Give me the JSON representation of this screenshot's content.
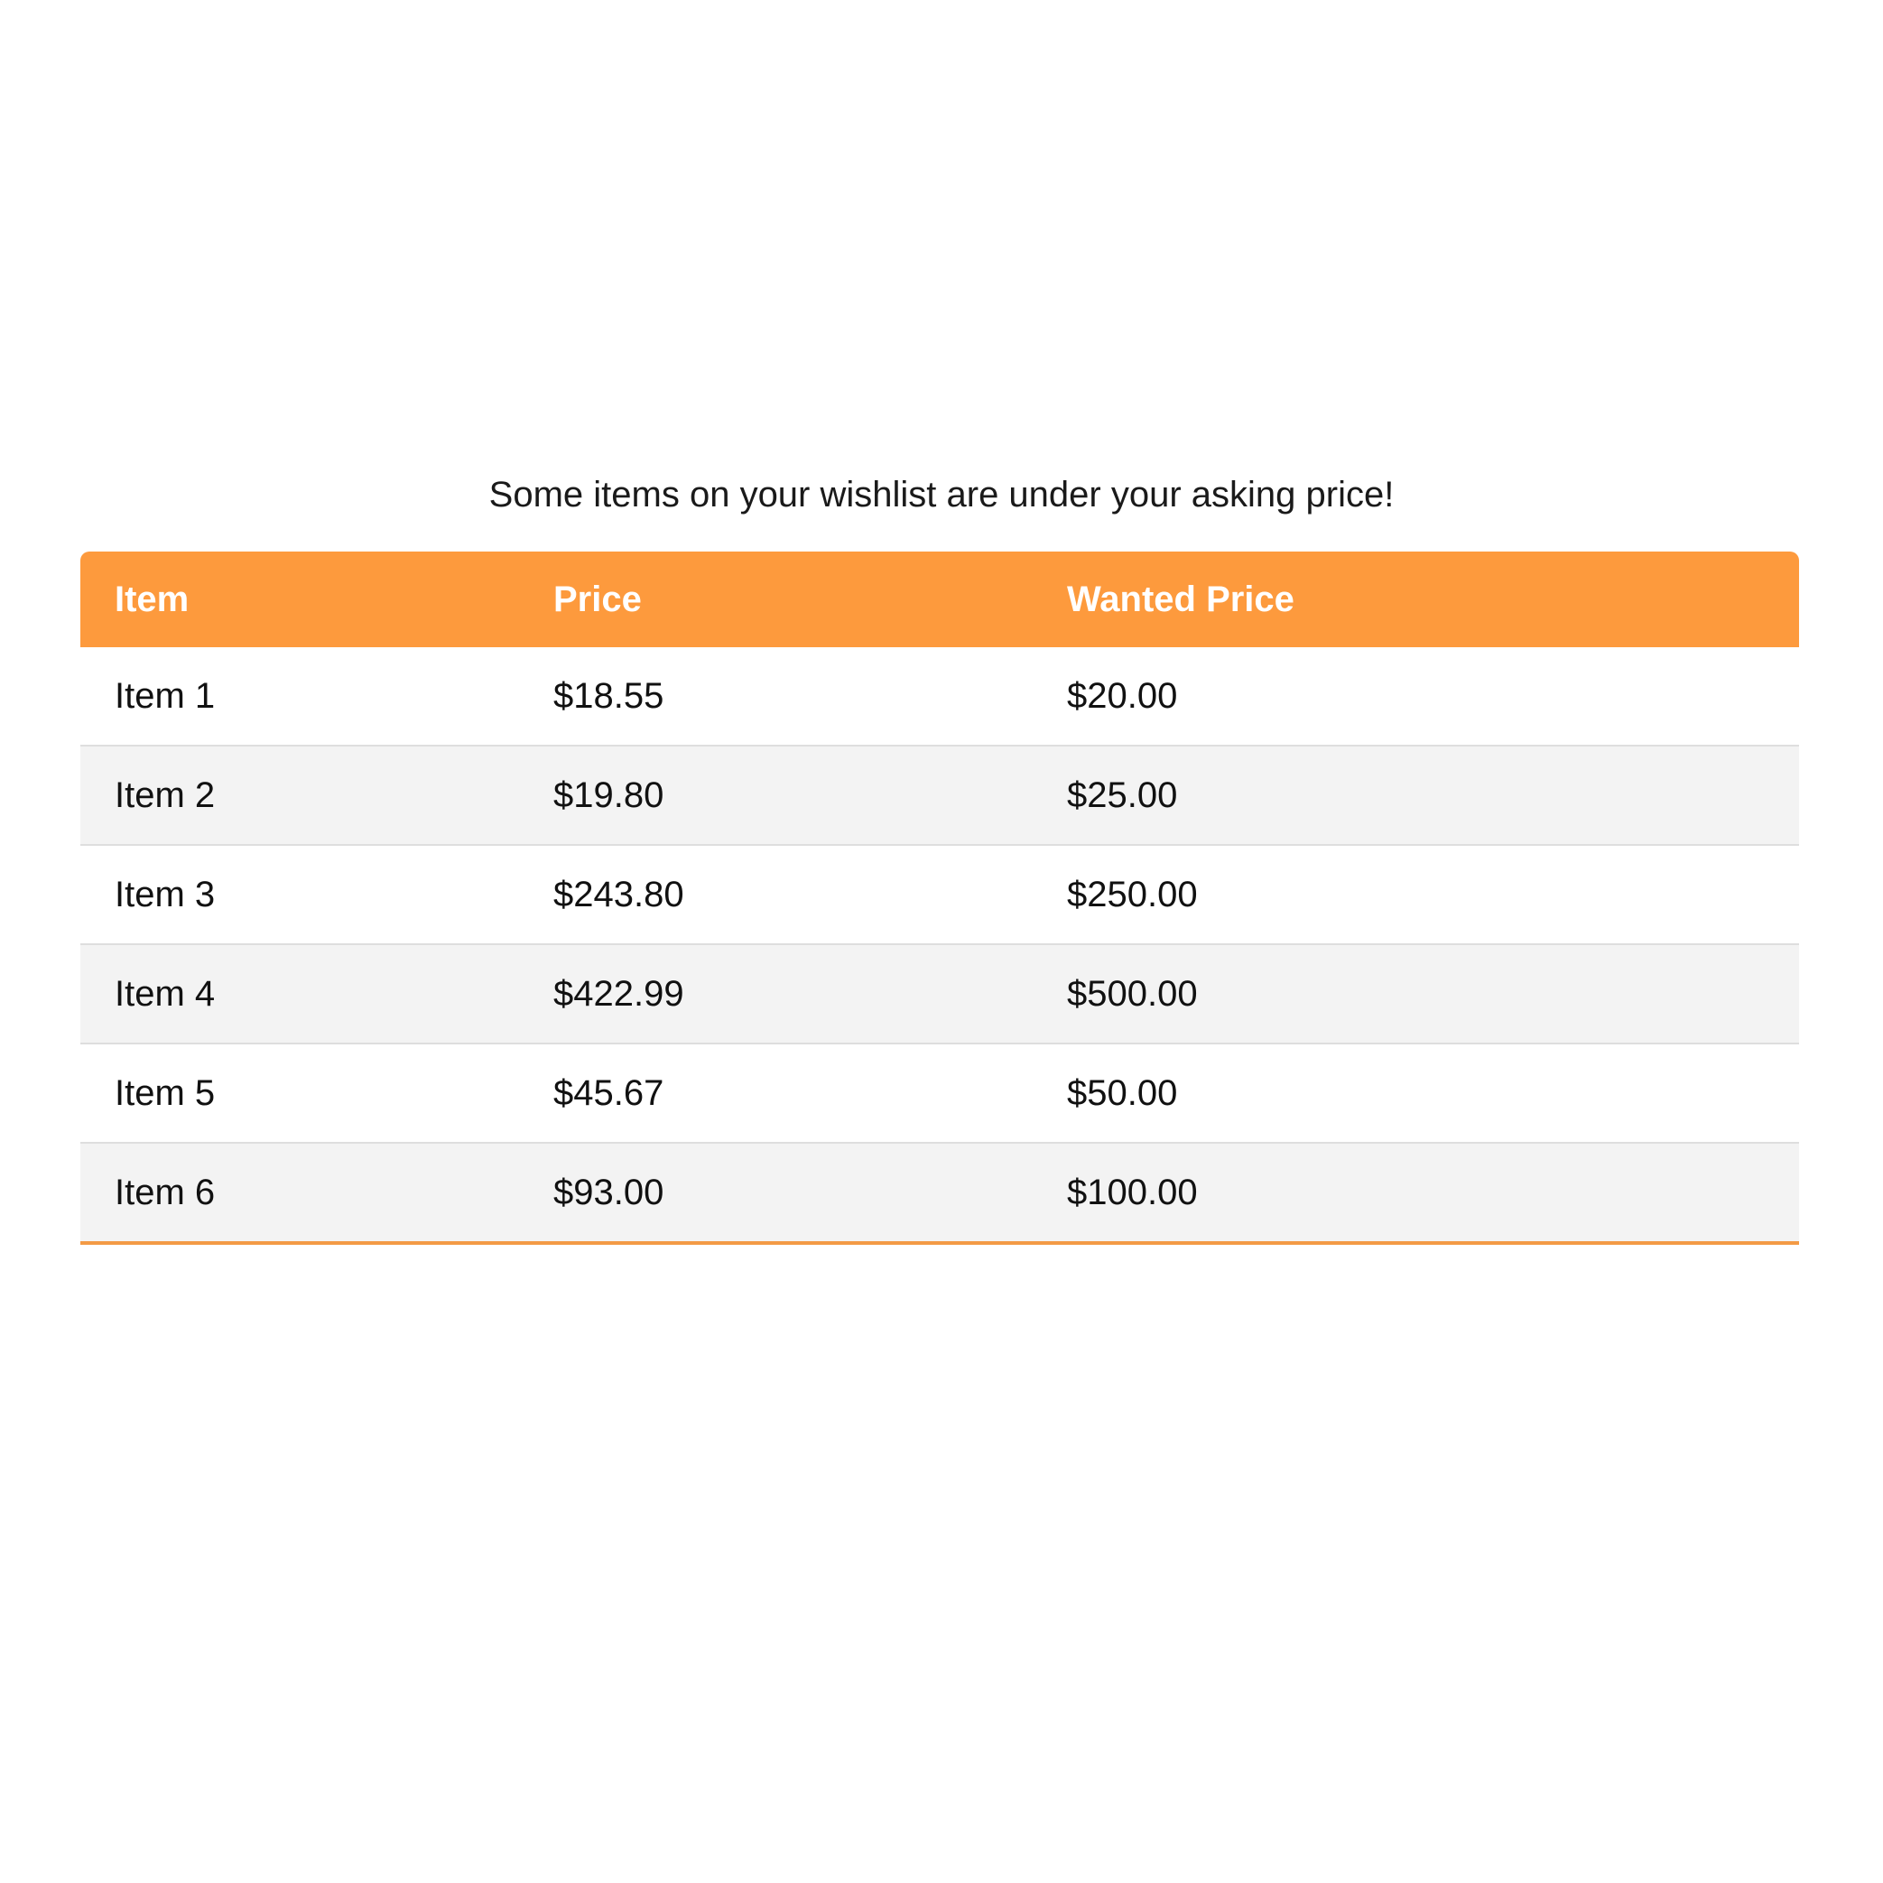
{
  "message": "Some items on your wishlist are under your asking price!",
  "table": {
    "headers": [
      "Item",
      "Price",
      "Wanted Price"
    ],
    "rows": [
      {
        "item": "Item 1",
        "price": "$18.55",
        "wanted": "$20.00"
      },
      {
        "item": "Item 2",
        "price": "$19.80",
        "wanted": "$25.00"
      },
      {
        "item": "Item 3",
        "price": "$243.80",
        "wanted": "$250.00"
      },
      {
        "item": "Item 4",
        "price": "$422.99",
        "wanted": "$500.00"
      },
      {
        "item": "Item 5",
        "price": "$45.67",
        "wanted": "$50.00"
      },
      {
        "item": "Item 6",
        "price": "$93.00",
        "wanted": "$100.00"
      }
    ]
  },
  "colors": {
    "header_bg": "#fd9a3d",
    "header_text": "#ffffff",
    "stripe_bg": "#f3f3f3",
    "bottom_border": "#f39a45"
  }
}
